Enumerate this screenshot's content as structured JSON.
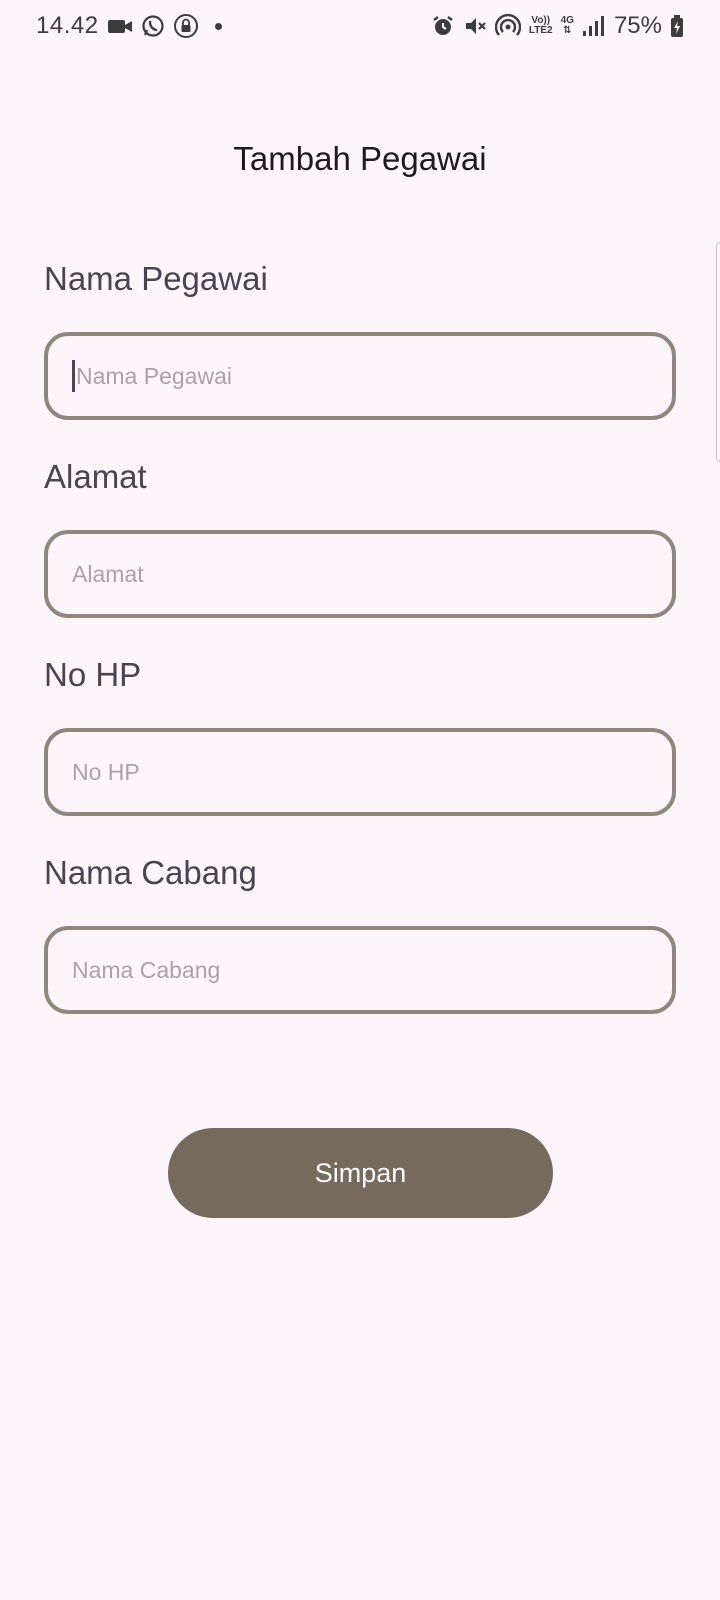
{
  "status_bar": {
    "time": "14.42",
    "network_top": "Vo))",
    "network_bottom": "LTE2",
    "data_type": "4G",
    "battery_percent": "75%",
    "icons": [
      "video-camera-icon",
      "whatsapp-icon",
      "lock-icon",
      "notification-dot",
      "alarm-icon",
      "mute-icon",
      "hotspot-icon",
      "volte-icon",
      "4g-icon",
      "signal-icon",
      "battery-charging-icon"
    ]
  },
  "title": "Tambah Pegawai",
  "form": {
    "nama_pegawai": {
      "label": "Nama Pegawai",
      "placeholder": "Nama Pegawai"
    },
    "alamat": {
      "label": "Alamat",
      "placeholder": "Alamat"
    },
    "no_hp": {
      "label": "No HP",
      "placeholder": "No HP"
    },
    "nama_cabang": {
      "label": "Nama Cabang",
      "placeholder": "Nama Cabang"
    }
  },
  "save_button": {
    "label": "Simpan",
    "color": "#766a5d"
  },
  "colors": {
    "background": "#fcf6fb",
    "input_border": "#8f877c",
    "placeholder": "#a9a2a6",
    "label": "#49454f"
  }
}
